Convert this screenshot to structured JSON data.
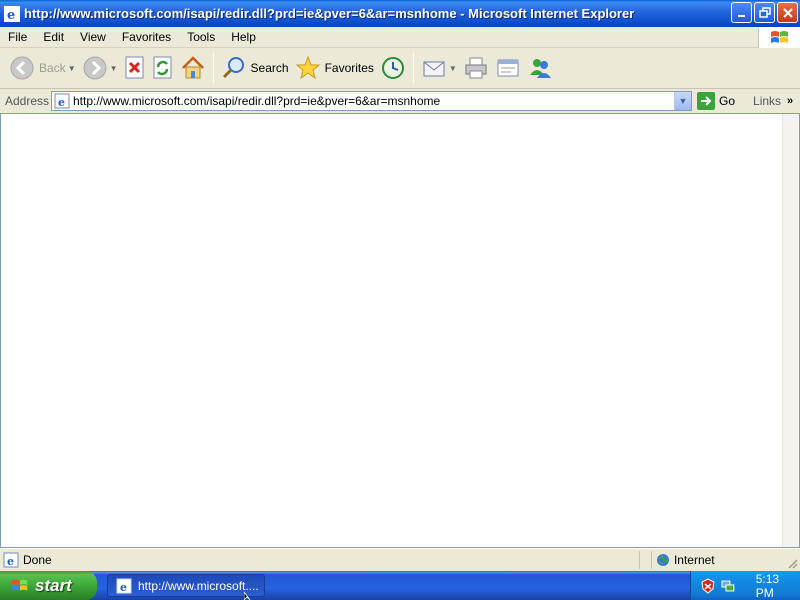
{
  "window": {
    "title": "http://www.microsoft.com/isapi/redir.dll?prd=ie&pver=6&ar=msnhome - Microsoft Internet Explorer",
    "minimize_icon": "minimize-icon",
    "maximize_icon": "maximize-icon",
    "close_icon": "close-icon"
  },
  "menubar": {
    "items": [
      "File",
      "Edit",
      "View",
      "Favorites",
      "Tools",
      "Help"
    ]
  },
  "toolbar": {
    "back_label": "Back",
    "search_label": "Search",
    "favorites_label": "Favorites"
  },
  "address": {
    "label": "Address",
    "url": "http://www.microsoft.com/isapi/redir.dll?prd=ie&pver=6&ar=msnhome",
    "go_label": "Go",
    "links_label": "Links"
  },
  "status": {
    "text": "Done",
    "zone": "Internet"
  },
  "taskbar": {
    "start_label": "start",
    "task_label": "http://www.microsoft....",
    "clock": "5:13 PM"
  },
  "colors": {
    "titlebar": "#0a4ccc",
    "taskbar": "#2157d7",
    "start": "#3aa536"
  }
}
